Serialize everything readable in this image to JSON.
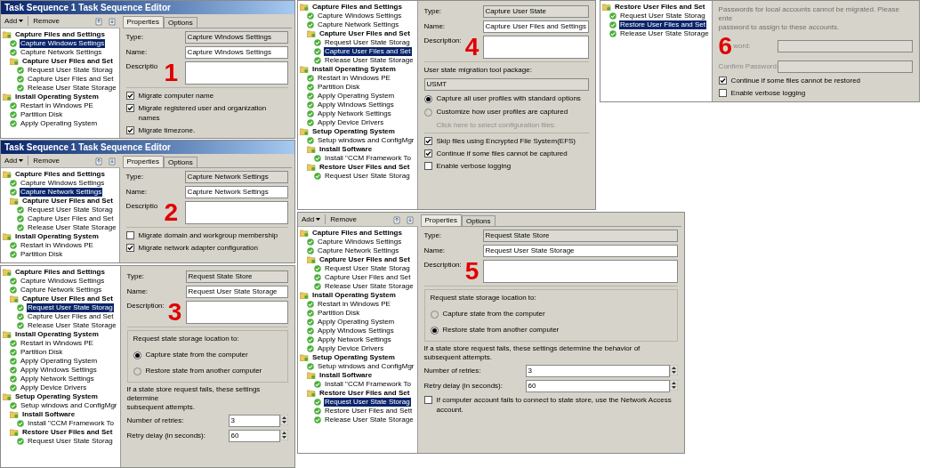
{
  "windows": [
    {
      "title": "Task Sequence 1 Task Sequence Editor",
      "toolbar": {
        "add": "Add",
        "remove": "Remove"
      },
      "tree": [
        {
          "kind": "group",
          "label": "Capture Files and Settings",
          "selected": false,
          "children": [
            {
              "kind": "step",
              "label": "Capture Windows Settings",
              "selected": true
            },
            {
              "kind": "step",
              "label": "Capture Network Settings",
              "selected": false
            },
            {
              "kind": "group",
              "label": "Capture User Files and Set",
              "selected": false,
              "children": [
                {
                  "kind": "step",
                  "label": "Request User State Storag",
                  "selected": false
                },
                {
                  "kind": "step",
                  "label": "Capture User Files and Set",
                  "selected": false
                },
                {
                  "kind": "step",
                  "label": "Release User State Storage",
                  "selected": false
                }
              ]
            }
          ]
        },
        {
          "kind": "group",
          "label": "Install Operating System",
          "selected": false,
          "children": [
            {
              "kind": "step",
              "label": "Restart in Windows PE",
              "selected": false
            },
            {
              "kind": "step",
              "label": "Partition Disk",
              "selected": false
            },
            {
              "kind": "step",
              "label": "Apply Operating System",
              "selected": false
            }
          ]
        }
      ],
      "tabs": [
        {
          "label": "Properties",
          "selected": true
        },
        {
          "label": "Options",
          "selected": false
        }
      ],
      "props": [
        {
          "kind": "field",
          "label": "Type:",
          "value": "Capture Windows Settings",
          "readonly": true
        },
        {
          "kind": "field",
          "label": "Name:",
          "value": "Capture Windows Settings",
          "readonly": false
        },
        {
          "kind": "textarea",
          "label": "Descriptio",
          "marker": "1"
        },
        {
          "kind": "rule"
        },
        {
          "kind": "checkbox",
          "label": "Migrate computer name",
          "checked": true
        },
        {
          "kind": "checkbox",
          "label": "Migrate registered user and organization names",
          "checked": true
        },
        {
          "kind": "checkbox",
          "label": "Migrate timezone.",
          "checked": true
        }
      ]
    },
    {
      "title": "Task Sequence 1 Task Sequence Editor",
      "toolbar": {
        "add": "Add",
        "remove": "Remove"
      },
      "tree": [
        {
          "kind": "group",
          "label": "Capture Files and Settings",
          "selected": false,
          "children": [
            {
              "kind": "step",
              "label": "Capture Windows Settings",
              "selected": false
            },
            {
              "kind": "step",
              "label": "Capture Network Settings",
              "selected": true
            },
            {
              "kind": "group",
              "label": "Capture User Files and Set",
              "selected": false,
              "children": [
                {
                  "kind": "step",
                  "label": "Request User State Storag",
                  "selected": false
                },
                {
                  "kind": "step",
                  "label": "Capture User Files and Set",
                  "selected": false
                },
                {
                  "kind": "step",
                  "label": "Release User State Storage",
                  "selected": false
                }
              ]
            }
          ]
        },
        {
          "kind": "group",
          "label": "Install Operating System",
          "selected": false,
          "children": [
            {
              "kind": "step",
              "label": "Restart in Windows PE",
              "selected": false
            },
            {
              "kind": "step",
              "label": "Partition Disk",
              "selected": false
            }
          ]
        }
      ],
      "tabs": [
        {
          "label": "Properties",
          "selected": true
        },
        {
          "label": "Options",
          "selected": false
        }
      ],
      "props": [
        {
          "kind": "field",
          "label": "Type:",
          "value": "Capture Network Settings",
          "readonly": true
        },
        {
          "kind": "field",
          "label": "Name:",
          "value": "Capture Network Settings",
          "readonly": false
        },
        {
          "kind": "textarea",
          "label": "Descriptio",
          "marker": "2"
        },
        {
          "kind": "rule"
        },
        {
          "kind": "checkbox",
          "label": "Migrate domain and workgroup membership",
          "checked": false
        },
        {
          "kind": "checkbox",
          "label": "Migrate network adapter configuration",
          "checked": true
        }
      ]
    },
    {
      "tree": [
        {
          "kind": "group",
          "label": "Capture Files and Settings",
          "selected": false,
          "children": [
            {
              "kind": "step",
              "label": "Capture Windows Settings",
              "selected": false
            },
            {
              "kind": "step",
              "label": "Capture Network Settings",
              "selected": false
            },
            {
              "kind": "group",
              "label": "Capture User Files and Set",
              "selected": false,
              "children": [
                {
                  "kind": "step",
                  "label": "Request User State Storag",
                  "selected": true
                },
                {
                  "kind": "step",
                  "label": "Capture User Files and Set",
                  "selected": false
                },
                {
                  "kind": "step",
                  "label": "Release User State Storage",
                  "selected": false
                }
              ]
            }
          ]
        },
        {
          "kind": "group",
          "label": "Install Operating System",
          "selected": false,
          "children": [
            {
              "kind": "step",
              "label": "Restart in Windows PE",
              "selected": false
            },
            {
              "kind": "step",
              "label": "Partition Disk",
              "selected": false
            },
            {
              "kind": "step",
              "label": "Apply Operating System",
              "selected": false
            },
            {
              "kind": "step",
              "label": "Apply Windows Settings",
              "selected": false
            },
            {
              "kind": "step",
              "label": "Apply Network Settings",
              "selected": false
            },
            {
              "kind": "step",
              "label": "Apply Device Drivers",
              "selected": false
            }
          ]
        },
        {
          "kind": "group",
          "label": "Setup Operating System",
          "selected": false,
          "children": [
            {
              "kind": "step",
              "label": "Setup windows and ConfigMgr",
              "selected": false
            },
            {
              "kind": "group",
              "label": "Install Software",
              "selected": false,
              "children": [
                {
                  "kind": "step",
                  "label": "Install \"CCM Framework To",
                  "selected": false
                }
              ]
            },
            {
              "kind": "group",
              "label": "Restore User Files and Set",
              "selected": false,
              "children": [
                {
                  "kind": "step",
                  "label": "Request User State Storag",
                  "selected": false
                }
              ]
            }
          ]
        }
      ],
      "props": [
        {
          "kind": "field",
          "label": "Type:",
          "value": "Request State Store",
          "readonly": true
        },
        {
          "kind": "field",
          "label": "Name:",
          "value": "Request User State Storage",
          "readonly": false
        },
        {
          "kind": "textarea",
          "label": "Description:",
          "marker": "3"
        },
        {
          "kind": "rule"
        },
        {
          "kind": "group",
          "title": "Request state storage location to:",
          "items": [
            {
              "label": "Capture state from the computer",
              "selected": true
            },
            {
              "label": "Restore state from another computer",
              "selected": false
            }
          ]
        },
        {
          "kind": "note",
          "text": "If a state store request fails, these settings determine\nsubsequent attempts.",
          "disabled": false
        },
        {
          "kind": "spin",
          "label": "Number of retries:",
          "value": "3"
        },
        {
          "kind": "spin",
          "label": "Retry delay (in seconds):",
          "value": "60"
        }
      ]
    },
    {
      "tree": [
        {
          "kind": "group",
          "label": "Capture Files and Settings",
          "selected": false,
          "children": [
            {
              "kind": "step",
              "label": "Capture Windows Settings",
              "selected": false
            },
            {
              "kind": "step",
              "label": "Capture Network Settings",
              "selected": false
            },
            {
              "kind": "group",
              "label": "Capture User Files and Set",
              "selected": false,
              "children": [
                {
                  "kind": "step",
                  "label": "Request User State Storag",
                  "selected": false
                },
                {
                  "kind": "step",
                  "label": "Capture User Files and Set",
                  "selected": true
                },
                {
                  "kind": "step",
                  "label": "Release User State Storage",
                  "selected": false
                }
              ]
            }
          ]
        },
        {
          "kind": "group",
          "label": "Install Operating System",
          "selected": false,
          "children": [
            {
              "kind": "step",
              "label": "Restart in Windows PE",
              "selected": false
            },
            {
              "kind": "step",
              "label": "Partition Disk",
              "selected": false
            },
            {
              "kind": "step",
              "label": "Apply Operating System",
              "selected": false
            },
            {
              "kind": "step",
              "label": "Apply Windows Settings",
              "selected": false
            },
            {
              "kind": "step",
              "label": "Apply Network Settings",
              "selected": false
            },
            {
              "kind": "step",
              "label": "Apply Device Drivers",
              "selected": false
            }
          ]
        },
        {
          "kind": "group",
          "label": "Setup Operating System",
          "selected": false,
          "children": [
            {
              "kind": "step",
              "label": "Setup windows and ConfigMgr",
              "selected": false
            },
            {
              "kind": "group",
              "label": "Install Software",
              "selected": false,
              "children": [
                {
                  "kind": "step",
                  "label": "Install \"CCM Framework To",
                  "selected": false
                }
              ]
            },
            {
              "kind": "group",
              "label": "Restore User Files and Set",
              "selected": false,
              "children": [
                {
                  "kind": "step",
                  "label": "Request User State Storag",
                  "selected": false
                }
              ]
            }
          ]
        }
      ],
      "props": [
        {
          "kind": "field",
          "label": "Type:",
          "value": "Capture User State",
          "readonly": true
        },
        {
          "kind": "field",
          "label": "Name:",
          "value": "Capture User Files and Settings",
          "readonly": false
        },
        {
          "kind": "textarea",
          "label": "Description:",
          "marker": "4"
        },
        {
          "kind": "rule"
        },
        {
          "kind": "label",
          "text": "User state migration tool package:"
        },
        {
          "kind": "box",
          "value": "USMT"
        },
        {
          "kind": "radio",
          "label": "Capture all user profiles with standard options",
          "selected": true
        },
        {
          "kind": "radio",
          "label": "Customize how user profiles are captured",
          "selected": false
        },
        {
          "kind": "link",
          "text": "Click here to select configuration files:",
          "disabled": true
        },
        {
          "kind": "rule"
        },
        {
          "kind": "checkbox",
          "label": "Skip files using Encrypted File System(EFS)",
          "checked": true
        },
        {
          "kind": "checkbox",
          "label": "Continue if some files cannot be captured",
          "checked": true
        },
        {
          "kind": "checkbox",
          "label": "Enable verbose logging",
          "checked": false
        }
      ]
    },
    {
      "toolbar": {
        "add": "Add",
        "remove": "Remove"
      },
      "tree": [
        {
          "kind": "group",
          "label": "Capture Files and Settings",
          "selected": false,
          "children": [
            {
              "kind": "step",
              "label": "Capture Windows Settings",
              "selected": false
            },
            {
              "kind": "step",
              "label": "Capture Network Settings",
              "selected": false
            },
            {
              "kind": "group",
              "label": "Capture User Files and Set",
              "selected": false,
              "children": [
                {
                  "kind": "step",
                  "label": "Request User State Storag",
                  "selected": false
                },
                {
                  "kind": "step",
                  "label": "Capture User Files and Set",
                  "selected": false
                },
                {
                  "kind": "step",
                  "label": "Release User State Storage",
                  "selected": false
                }
              ]
            }
          ]
        },
        {
          "kind": "group",
          "label": "Install Operating System",
          "selected": false,
          "children": [
            {
              "kind": "step",
              "label": "Restart in Windows PE",
              "selected": false
            },
            {
              "kind": "step",
              "label": "Partition Disk",
              "selected": false
            },
            {
              "kind": "step",
              "label": "Apply Operating System",
              "selected": false
            },
            {
              "kind": "step",
              "label": "Apply Windows Settings",
              "selected": false
            },
            {
              "kind": "step",
              "label": "Apply Network Settings",
              "selected": false
            },
            {
              "kind": "step",
              "label": "Apply Device Drivers",
              "selected": false
            }
          ]
        },
        {
          "kind": "group",
          "label": "Setup Operating System",
          "selected": false,
          "children": [
            {
              "kind": "step",
              "label": "Setup windows and ConfigMgr",
              "selected": false
            },
            {
              "kind": "group",
              "label": "Install Software",
              "selected": false,
              "children": [
                {
                  "kind": "step",
                  "label": "Install \"CCM Framework To",
                  "selected": false
                }
              ]
            },
            {
              "kind": "group",
              "label": "Restore User Files and Set",
              "selected": false,
              "children": [
                {
                  "kind": "step",
                  "label": "Request User State Storag",
                  "selected": true
                },
                {
                  "kind": "step",
                  "label": "Restore User Files and Sett",
                  "selected": false
                },
                {
                  "kind": "step",
                  "label": "Release User State Storage",
                  "selected": false
                }
              ]
            }
          ]
        }
      ],
      "tabs": [
        {
          "label": "Properties",
          "selected": true
        },
        {
          "label": "Options",
          "selected": false
        }
      ],
      "props": [
        {
          "kind": "field",
          "label": "Type:",
          "value": "Request State Store",
          "readonly": true
        },
        {
          "kind": "field",
          "label": "Name:",
          "value": "Request User State Storage",
          "readonly": false
        },
        {
          "kind": "textarea",
          "label": "Description:",
          "marker": "5"
        },
        {
          "kind": "rule"
        },
        {
          "kind": "group",
          "title": "Request state storage location to:",
          "items": [
            {
              "label": "Capture state from the computer",
              "selected": false
            },
            {
              "label": "Restore state from another computer",
              "selected": true
            }
          ]
        },
        {
          "kind": "note",
          "text": "If a state store request fails, these settings determine the behavior of subsequent attempts.",
          "disabled": false
        },
        {
          "kind": "spin",
          "label": "Number of retries:",
          "value": "3"
        },
        {
          "kind": "spin",
          "label": "Retry delay (in seconds):",
          "value": "60"
        },
        {
          "kind": "checkbox",
          "label": "If computer account fails to connect to state store, use the Network Access account.",
          "checked": false
        }
      ]
    },
    {
      "tree": [
        {
          "kind": "group",
          "label": "Restore User Files and Set",
          "selected": false,
          "children": [
            {
              "kind": "step",
              "label": "Request User State Storag",
              "selected": false
            },
            {
              "kind": "step",
              "label": "Restore User Files and Set",
              "selected": true
            },
            {
              "kind": "step",
              "label": "Release User State Storage",
              "selected": false
            }
          ]
        }
      ],
      "props": [
        {
          "kind": "note",
          "text": "Passwords for local accounts cannot be migrated. Please ente\npassword to assign to these accounts.",
          "disabled": true
        },
        {
          "kind": "field",
          "label": "word:",
          "readonly": true,
          "marker": "6"
        },
        {
          "kind": "field",
          "label": "Confirm Password:",
          "readonly": true
        },
        {
          "kind": "checkbox",
          "label": "Continue if some files cannot be restored",
          "checked": true
        },
        {
          "kind": "checkbox",
          "label": "Enable verbose logging",
          "checked": false
        }
      ]
    }
  ]
}
